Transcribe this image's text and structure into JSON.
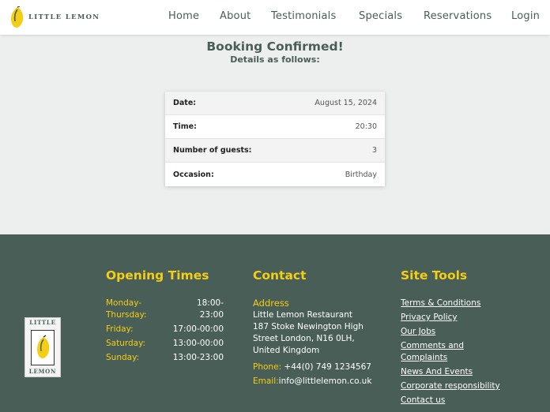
{
  "brand": {
    "logo_text": "LITTLE LEMON"
  },
  "nav": [
    "Home",
    "About",
    "Testimonials",
    "Specials",
    "Reservations",
    "Login"
  ],
  "confirmation": {
    "title": "Booking Confirmed!",
    "subtitle": "Details as follows:",
    "rows": [
      {
        "label": "Date:",
        "value": "August 15, 2024"
      },
      {
        "label": "Time:",
        "value": "20:30"
      },
      {
        "label": "Number of guests:",
        "value": "3"
      },
      {
        "label": "Occasion:",
        "value": "Birthday"
      }
    ]
  },
  "footer": {
    "logo_top": "LITTLE",
    "logo_bottom": "LEMON",
    "opening_title": "Opening Times",
    "hours": [
      {
        "day": "Monday-Thursday:",
        "time": "18:00-23:00"
      },
      {
        "day": "Friday:",
        "time": "17:00-00:00"
      },
      {
        "day": "Saturday:",
        "time": "13:00-00:00"
      },
      {
        "day": "Sunday:",
        "time": "13:00-23:00"
      }
    ],
    "contact_title": "Contact",
    "address_label": "Address",
    "address_lines": [
      "Little Lemon Restaurant",
      "187 Stoke Newington High",
      "Street London, N16 0LH,",
      "United Kingdom"
    ],
    "phone_label": "Phone:",
    "phone": "+44(0) 749 1234567",
    "email_label": "Email:",
    "email": "info@littlelemon.co.uk",
    "tools_title": "Site Tools",
    "tools": [
      "Terms & Conditions",
      "Privacy Policy",
      "Our Jobs",
      "Comments and Complaints",
      "News And Events",
      "Corporate responsibility",
      "Contact us"
    ]
  },
  "colors": {
    "primary": "#495e57",
    "accent": "#f4ce14",
    "background": "#edefee"
  }
}
